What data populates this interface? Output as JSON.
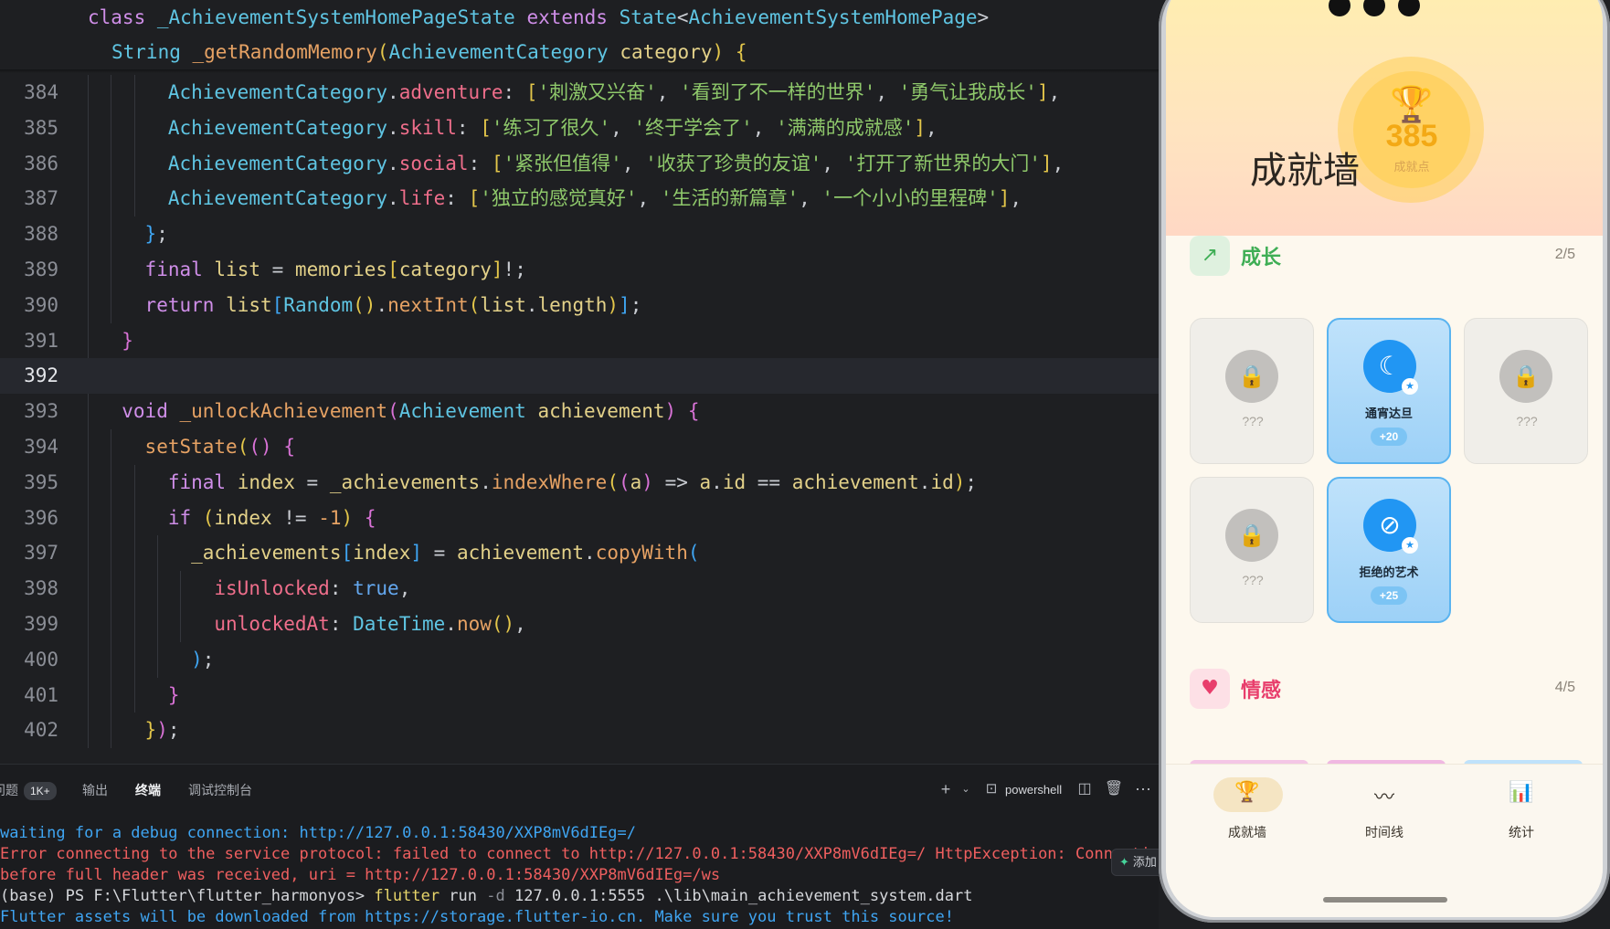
{
  "editor": {
    "sticky": [
      {
        "tokens": [
          [
            "k",
            "class "
          ],
          [
            "t",
            "_AchievementSystemHomePageState "
          ],
          [
            "k",
            "extends "
          ],
          [
            "t",
            "State"
          ],
          [
            "w",
            "<"
          ],
          [
            "t",
            "AchievementSystemHomePage"
          ],
          [
            "w",
            ">"
          ]
        ]
      },
      {
        "tokens": [
          [
            "t",
            "String "
          ],
          [
            "fn",
            "_getRandomMemory"
          ],
          [
            "b1",
            "("
          ],
          [
            "t",
            "AchievementCategory "
          ],
          [
            "v",
            "category"
          ],
          [
            "b1",
            ")"
          ],
          [
            "w",
            " "
          ],
          [
            "b1",
            "{"
          ]
        ]
      }
    ],
    "lines": [
      {
        "num": "384",
        "indent": 6,
        "tokens": [
          [
            "t",
            "AchievementCategory"
          ],
          [
            "w",
            "."
          ],
          [
            "p",
            "adventure"
          ],
          [
            "w",
            ": "
          ],
          [
            "b1",
            "["
          ],
          [
            "s",
            "'刺激又兴奋'"
          ],
          [
            "w",
            ", "
          ],
          [
            "s",
            "'看到了不一样的世界'"
          ],
          [
            "w",
            ", "
          ],
          [
            "s",
            "'勇气让我成长'"
          ],
          [
            "b1",
            "]"
          ],
          [
            "w",
            ","
          ]
        ]
      },
      {
        "num": "385",
        "indent": 6,
        "tokens": [
          [
            "t",
            "AchievementCategory"
          ],
          [
            "w",
            "."
          ],
          [
            "p",
            "skill"
          ],
          [
            "w",
            ": "
          ],
          [
            "b1",
            "["
          ],
          [
            "s",
            "'练习了很久'"
          ],
          [
            "w",
            ", "
          ],
          [
            "s",
            "'终于学会了'"
          ],
          [
            "w",
            ", "
          ],
          [
            "s",
            "'满满的成就感'"
          ],
          [
            "b1",
            "]"
          ],
          [
            "w",
            ","
          ]
        ]
      },
      {
        "num": "386",
        "indent": 6,
        "tokens": [
          [
            "t",
            "AchievementCategory"
          ],
          [
            "w",
            "."
          ],
          [
            "p",
            "social"
          ],
          [
            "w",
            ": "
          ],
          [
            "b1",
            "["
          ],
          [
            "s",
            "'紧张但值得'"
          ],
          [
            "w",
            ", "
          ],
          [
            "s",
            "'收获了珍贵的友谊'"
          ],
          [
            "w",
            ", "
          ],
          [
            "s",
            "'打开了新世界的大门'"
          ],
          [
            "b1",
            "]"
          ],
          [
            "w",
            ","
          ]
        ]
      },
      {
        "num": "387",
        "indent": 6,
        "tokens": [
          [
            "t",
            "AchievementCategory"
          ],
          [
            "w",
            "."
          ],
          [
            "p",
            "life"
          ],
          [
            "w",
            ": "
          ],
          [
            "b1",
            "["
          ],
          [
            "s",
            "'独立的感觉真好'"
          ],
          [
            "w",
            ", "
          ],
          [
            "s",
            "'生活的新篇章'"
          ],
          [
            "w",
            ", "
          ],
          [
            "s",
            "'一个小小的里程碑'"
          ],
          [
            "b1",
            "]"
          ],
          [
            "w",
            ","
          ]
        ]
      },
      {
        "num": "388",
        "indent": 4,
        "tokens": [
          [
            "b3",
            "}"
          ],
          [
            "w",
            ";"
          ]
        ]
      },
      {
        "num": "389",
        "indent": 4,
        "tokens": [
          [
            "k",
            "final "
          ],
          [
            "v",
            "list "
          ],
          [
            "w",
            "= "
          ],
          [
            "v",
            "memories"
          ],
          [
            "b1",
            "["
          ],
          [
            "v",
            "category"
          ],
          [
            "b1",
            "]"
          ],
          [
            "w",
            "!;"
          ]
        ]
      },
      {
        "num": "390",
        "indent": 4,
        "tokens": [
          [
            "k",
            "return "
          ],
          [
            "v",
            "list"
          ],
          [
            "b3",
            "["
          ],
          [
            "t",
            "Random"
          ],
          [
            "b1",
            "()"
          ],
          [
            "w",
            "."
          ],
          [
            "fn",
            "nextInt"
          ],
          [
            "b1",
            "("
          ],
          [
            "v",
            "list"
          ],
          [
            "w",
            "."
          ],
          [
            "v",
            "length"
          ],
          [
            "b1",
            ")"
          ],
          [
            "b3",
            "]"
          ],
          [
            "w",
            ";"
          ]
        ]
      },
      {
        "num": "391",
        "indent": 2,
        "tokens": [
          [
            "b2",
            "}"
          ]
        ]
      },
      {
        "num": "392",
        "indent": 0,
        "active": true,
        "tokens": []
      },
      {
        "num": "393",
        "indent": 2,
        "tokens": [
          [
            "k",
            "void "
          ],
          [
            "fn",
            "_unlockAchievement"
          ],
          [
            "b2",
            "("
          ],
          [
            "t",
            "Achievement "
          ],
          [
            "v",
            "achievement"
          ],
          [
            "b2",
            ")"
          ],
          [
            "w",
            " "
          ],
          [
            "b2",
            "{"
          ]
        ]
      },
      {
        "num": "394",
        "indent": 4,
        "tokens": [
          [
            "fn",
            "setState"
          ],
          [
            "b1",
            "("
          ],
          [
            "b2",
            "()"
          ],
          [
            "w",
            " "
          ],
          [
            "b2",
            "{"
          ]
        ]
      },
      {
        "num": "395",
        "indent": 6,
        "tokens": [
          [
            "k",
            "final "
          ],
          [
            "v",
            "index "
          ],
          [
            "w",
            "= "
          ],
          [
            "v",
            "_achievements"
          ],
          [
            "w",
            "."
          ],
          [
            "fn",
            "indexWhere"
          ],
          [
            "b1",
            "("
          ],
          [
            "b2",
            "("
          ],
          [
            "v",
            "a"
          ],
          [
            "b2",
            ")"
          ],
          [
            "w",
            " => "
          ],
          [
            "v",
            "a"
          ],
          [
            "w",
            "."
          ],
          [
            "v",
            "id "
          ],
          [
            "w",
            "== "
          ],
          [
            "v",
            "achievement"
          ],
          [
            "w",
            "."
          ],
          [
            "v",
            "id"
          ],
          [
            "b1",
            ")"
          ],
          [
            "w",
            ";"
          ]
        ]
      },
      {
        "num": "396",
        "indent": 6,
        "tokens": [
          [
            "k",
            "if "
          ],
          [
            "b1",
            "("
          ],
          [
            "v",
            "index "
          ],
          [
            "w",
            "!= "
          ],
          [
            "n",
            "-1"
          ],
          [
            "b1",
            ")"
          ],
          [
            "w",
            " "
          ],
          [
            "b2",
            "{"
          ]
        ]
      },
      {
        "num": "397",
        "indent": 8,
        "tokens": [
          [
            "v",
            "_achievements"
          ],
          [
            "b3",
            "["
          ],
          [
            "v",
            "index"
          ],
          [
            "b3",
            "]"
          ],
          [
            "w",
            " = "
          ],
          [
            "v",
            "achievement"
          ],
          [
            "w",
            "."
          ],
          [
            "fn",
            "copyWith"
          ],
          [
            "b3",
            "("
          ]
        ]
      },
      {
        "num": "398",
        "indent": 10,
        "tokens": [
          [
            "p",
            "isUnlocked"
          ],
          [
            "w",
            ": "
          ],
          [
            "f",
            "true"
          ],
          [
            "w",
            ","
          ]
        ]
      },
      {
        "num": "399",
        "indent": 10,
        "tokens": [
          [
            "p",
            "unlockedAt"
          ],
          [
            "w",
            ": "
          ],
          [
            "t",
            "DateTime"
          ],
          [
            "w",
            "."
          ],
          [
            "fn",
            "now"
          ],
          [
            "b1",
            "()"
          ],
          [
            "w",
            ","
          ]
        ]
      },
      {
        "num": "400",
        "indent": 8,
        "tokens": [
          [
            "b3",
            ")"
          ],
          [
            "w",
            ";"
          ]
        ]
      },
      {
        "num": "401",
        "indent": 6,
        "tokens": [
          [
            "b2",
            "}"
          ]
        ]
      },
      {
        "num": "402",
        "indent": 4,
        "tokens": [
          [
            "b1",
            "}"
          ],
          [
            "b2",
            ")"
          ],
          [
            "w",
            ";"
          ]
        ]
      }
    ]
  },
  "panel": {
    "tabs": {
      "problems": "问题",
      "problems_count": "1K+",
      "output": "输出",
      "terminal": "终端",
      "debug_console": "调试控制台"
    },
    "shell_label": "powershell",
    "chip_label": "添加",
    "terminal_lines": [
      [
        [
          "tc",
          "waiting for a debug connection: http://127.0.0.1:58430/XXP8mV6dIEg=/"
        ]
      ],
      [
        [
          "tr",
          "Error connecting to the service protocol: failed to connect to http://127.0.0.1:58430/XXP8mV6dIEg=/ HttpException: Connection closed"
        ]
      ],
      [
        [
          "tr",
          "before full header was received, uri = http://127.0.0.1:58430/XXP8mV6dIEg=/ws"
        ]
      ],
      [
        [
          "tw",
          "(base) PS F:\\Flutter\\flutter_harmonyos> "
        ],
        [
          "ty",
          "flutter "
        ],
        [
          "tw",
          "run "
        ],
        [
          "tg",
          "-d "
        ],
        [
          "tw",
          "127.0.0.1:5555 .\\lib\\main_achievement_system.dart"
        ]
      ],
      [
        [
          "tc",
          "Flutter assets will be downloaded from https://storage.flutter-io.cn. Make sure you trust this source!"
        ]
      ]
    ]
  },
  "app": {
    "hero": {
      "score": "385",
      "score_label": "成就点",
      "title": "成就墙"
    },
    "categories": [
      {
        "name": "成长",
        "count": "2/5",
        "color": "#3fae55",
        "icon_bg": "#dff1df",
        "icon_name": "trending-up-icon"
      },
      {
        "name": "情感",
        "count": "4/5",
        "color": "#e83e6c",
        "icon_bg": "#fde0e6",
        "icon_name": "heart-icon"
      }
    ],
    "cards": [
      {
        "locked": true,
        "label": "???"
      },
      {
        "locked": false,
        "name": "通宵达旦",
        "points": "+20",
        "icon_name": "moon-off-icon"
      },
      {
        "locked": true,
        "label": "???"
      },
      {
        "locked": true,
        "label": "???"
      },
      {
        "locked": false,
        "name": "拒绝的艺术",
        "points": "+25",
        "icon_name": "block-icon"
      }
    ],
    "nav": [
      {
        "label": "成就墙",
        "icon_name": "trophy-icon",
        "active": true
      },
      {
        "label": "时间线",
        "icon_name": "timeline-icon",
        "active": false
      },
      {
        "label": "统计",
        "icon_name": "stats-icon",
        "active": false
      }
    ]
  }
}
